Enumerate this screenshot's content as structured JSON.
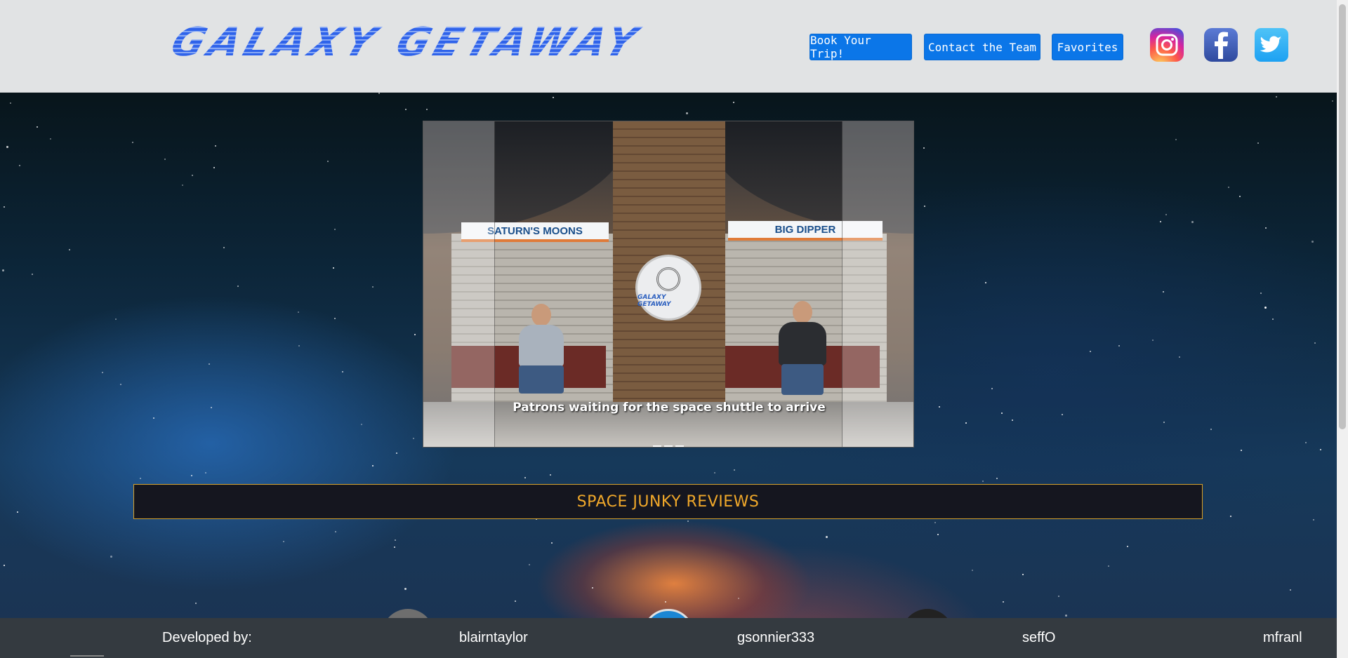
{
  "header": {
    "logo_text": "GALAXY GETAWAY",
    "nav": {
      "book_label": "Book Your Trip!",
      "contact_label": "Contact the Team",
      "favorites_label": "Favorites"
    },
    "social": {
      "instagram_icon": "instagram-icon",
      "facebook_icon": "facebook-icon",
      "twitter_icon": "twitter-icon"
    }
  },
  "carousel": {
    "slide": {
      "sign_left": "SATURN'S MOONS",
      "sign_right": "BIG DIPPER",
      "emblem_text": "GALAXY GETAWAY",
      "caption": "Patrons waiting for the space shuttle to arrive"
    },
    "indicator_count": 3,
    "active_indicator": 0
  },
  "reviews": {
    "title": "SPACE JUNKY REVIEWS"
  },
  "footer": {
    "developed_by": "Developed by:",
    "developers": [
      "blairntaylor",
      "gsonnier333",
      "seffO",
      "mfranl"
    ]
  },
  "colors": {
    "header_bg": "#e1e3e4",
    "nav_button": "#0b76e8",
    "reviews_accent": "#f0a82a",
    "footer_bg": "#343a40"
  }
}
